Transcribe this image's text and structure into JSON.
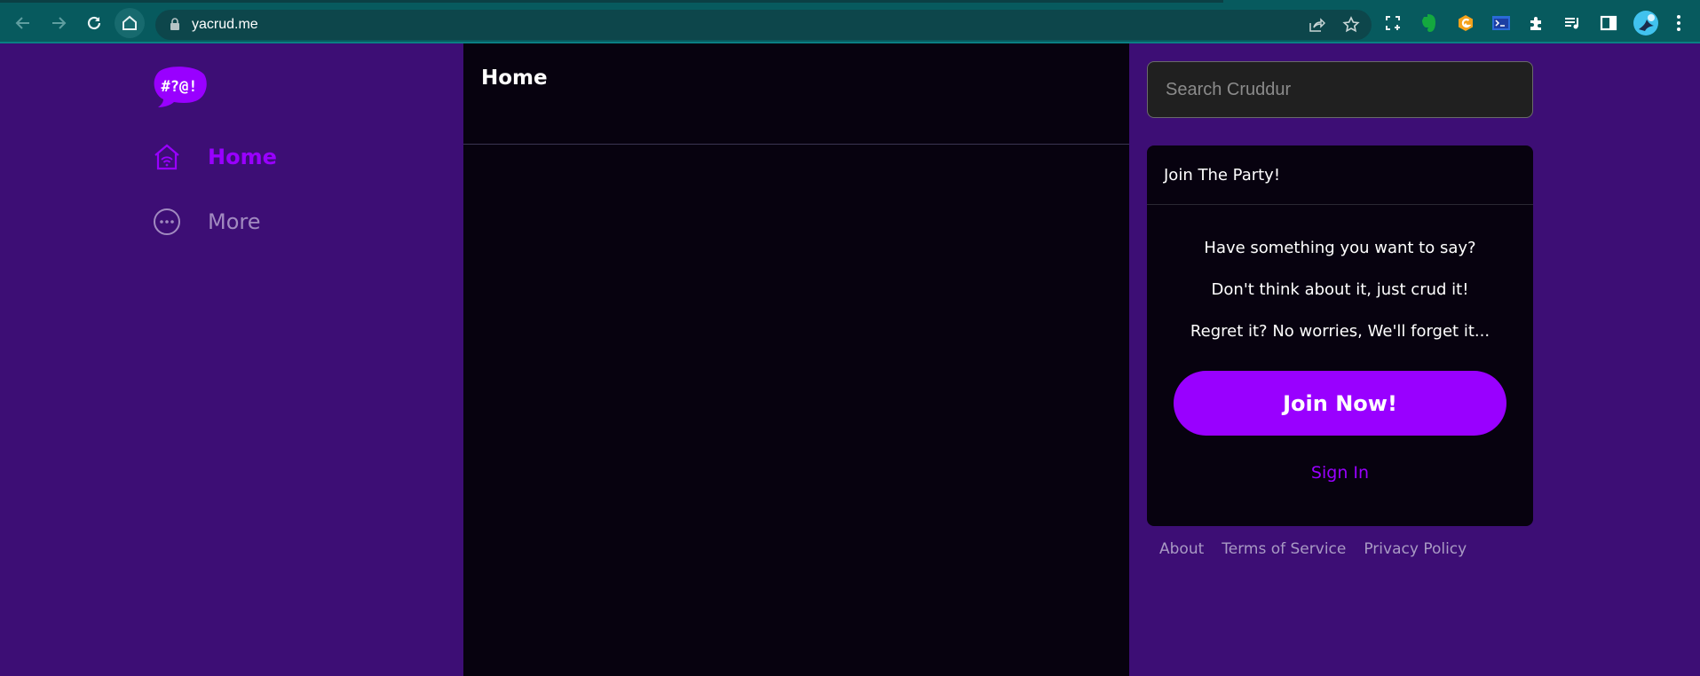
{
  "browser": {
    "url": "yacrud.me",
    "icons": {
      "back": "arrow-left-icon",
      "forward": "arrow-right-icon",
      "reload": "reload-icon",
      "home": "home-icon",
      "lock": "lock-icon",
      "share": "share-icon",
      "bookmark": "star-icon",
      "screenshot": "screen-capture-icon",
      "evernote": "evernote-icon",
      "grammarly": "g-extension-icon",
      "terminal": "terminal-icon",
      "extensions": "puzzle-icon",
      "media": "media-queue-icon",
      "sidepanel": "side-panel-icon",
      "profile": "profile-avatar",
      "menu": "kebab-menu-icon"
    }
  },
  "brand": {
    "logo_text": "#?@!",
    "accent": "#9900ff",
    "sidebar_bg": "#3d0e75",
    "content_bg": "#07020f"
  },
  "sidebar": {
    "items": [
      {
        "label": "Home",
        "icon": "home-wifi-icon",
        "active": true
      },
      {
        "label": "More",
        "icon": "more-circle-icon",
        "active": false
      }
    ]
  },
  "main": {
    "title": "Home"
  },
  "search": {
    "placeholder": "Search Cruddur",
    "value": ""
  },
  "join_card": {
    "title": "Join The Party!",
    "lines": [
      "Have something you want to say?",
      "Don't think about it, just crud it!",
      "Regret it? No worries, We'll forget it..."
    ],
    "join_label": "Join Now!",
    "signin_label": "Sign In"
  },
  "footer": {
    "links": [
      "About",
      "Terms of Service",
      "Privacy Policy"
    ]
  }
}
